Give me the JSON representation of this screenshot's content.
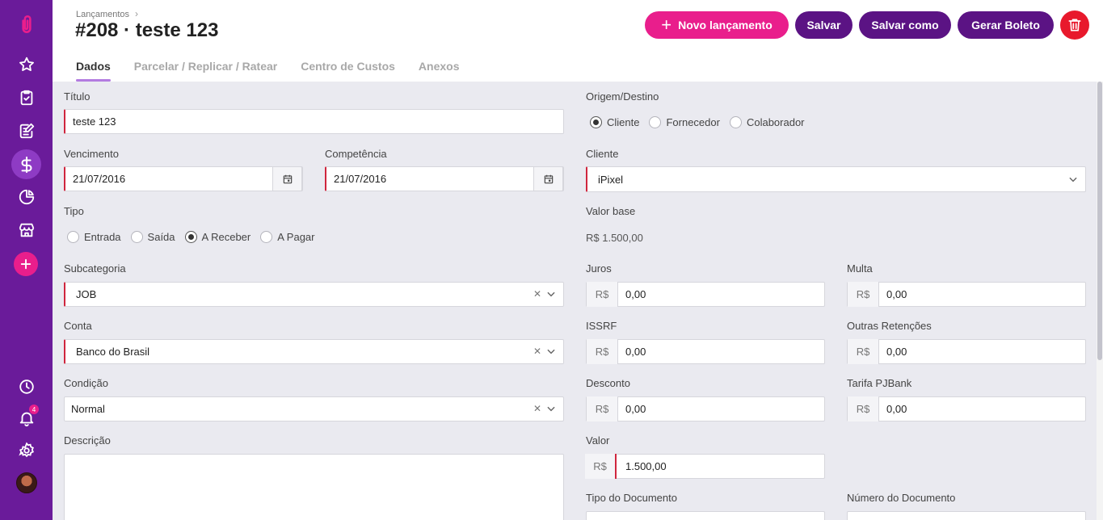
{
  "header": {
    "breadcrumb": "Lançamentos",
    "title": "#208 · teste 123",
    "actions": {
      "new_entry": "Novo lançamento",
      "save": "Salvar",
      "save_as": "Salvar como",
      "generate_boleto": "Gerar Boleto"
    },
    "tabs": [
      "Dados",
      "Parcelar / Replicar / Ratear",
      "Centro de Custos",
      "Anexos"
    ]
  },
  "sidebar": {
    "notification_count": "4"
  },
  "form": {
    "titulo": {
      "label": "Título",
      "value": "teste 123"
    },
    "vencimento": {
      "label": "Vencimento",
      "value": "21/07/2016"
    },
    "competencia": {
      "label": "Competência",
      "value": "21/07/2016"
    },
    "tipo": {
      "label": "Tipo",
      "options": [
        "Entrada",
        "Saída",
        "A Receber",
        "A Pagar"
      ],
      "selected": "A Receber"
    },
    "subcategoria": {
      "label": "Subcategoria",
      "value": "JOB"
    },
    "conta": {
      "label": "Conta",
      "value": "Banco do Brasil"
    },
    "condicao": {
      "label": "Condição",
      "value": "Normal"
    },
    "descricao": {
      "label": "Descrição",
      "value": ""
    },
    "origem": {
      "label": "Origem/Destino",
      "options": [
        "Cliente",
        "Fornecedor",
        "Colaborador"
      ],
      "selected": "Cliente"
    },
    "cliente": {
      "label": "Cliente",
      "value": "iPixel"
    },
    "valor_base": {
      "label": "Valor base",
      "value": "R$ 1.500,00"
    },
    "currency_prefix": "R$",
    "juros": {
      "label": "Juros",
      "value": "0,00"
    },
    "multa": {
      "label": "Multa",
      "value": "0,00"
    },
    "issrf": {
      "label": "ISSRF",
      "value": "0,00"
    },
    "outras_retencoes": {
      "label": "Outras Retenções",
      "value": "0,00"
    },
    "desconto": {
      "label": "Desconto",
      "value": "0,00"
    },
    "tarifa_pjbank": {
      "label": "Tarifa PJBank",
      "value": "0,00"
    },
    "valor": {
      "label": "Valor",
      "value": "1.500,00"
    },
    "tipo_documento": {
      "label": "Tipo do Documento"
    },
    "numero_documento": {
      "label": "Número do Documento"
    }
  },
  "colors": {
    "sidebar": "#6a1b9a",
    "accent_pink": "#e91e8c",
    "accent_purple": "#5b1384",
    "danger": "#e8192c",
    "required": "#d0263e"
  }
}
